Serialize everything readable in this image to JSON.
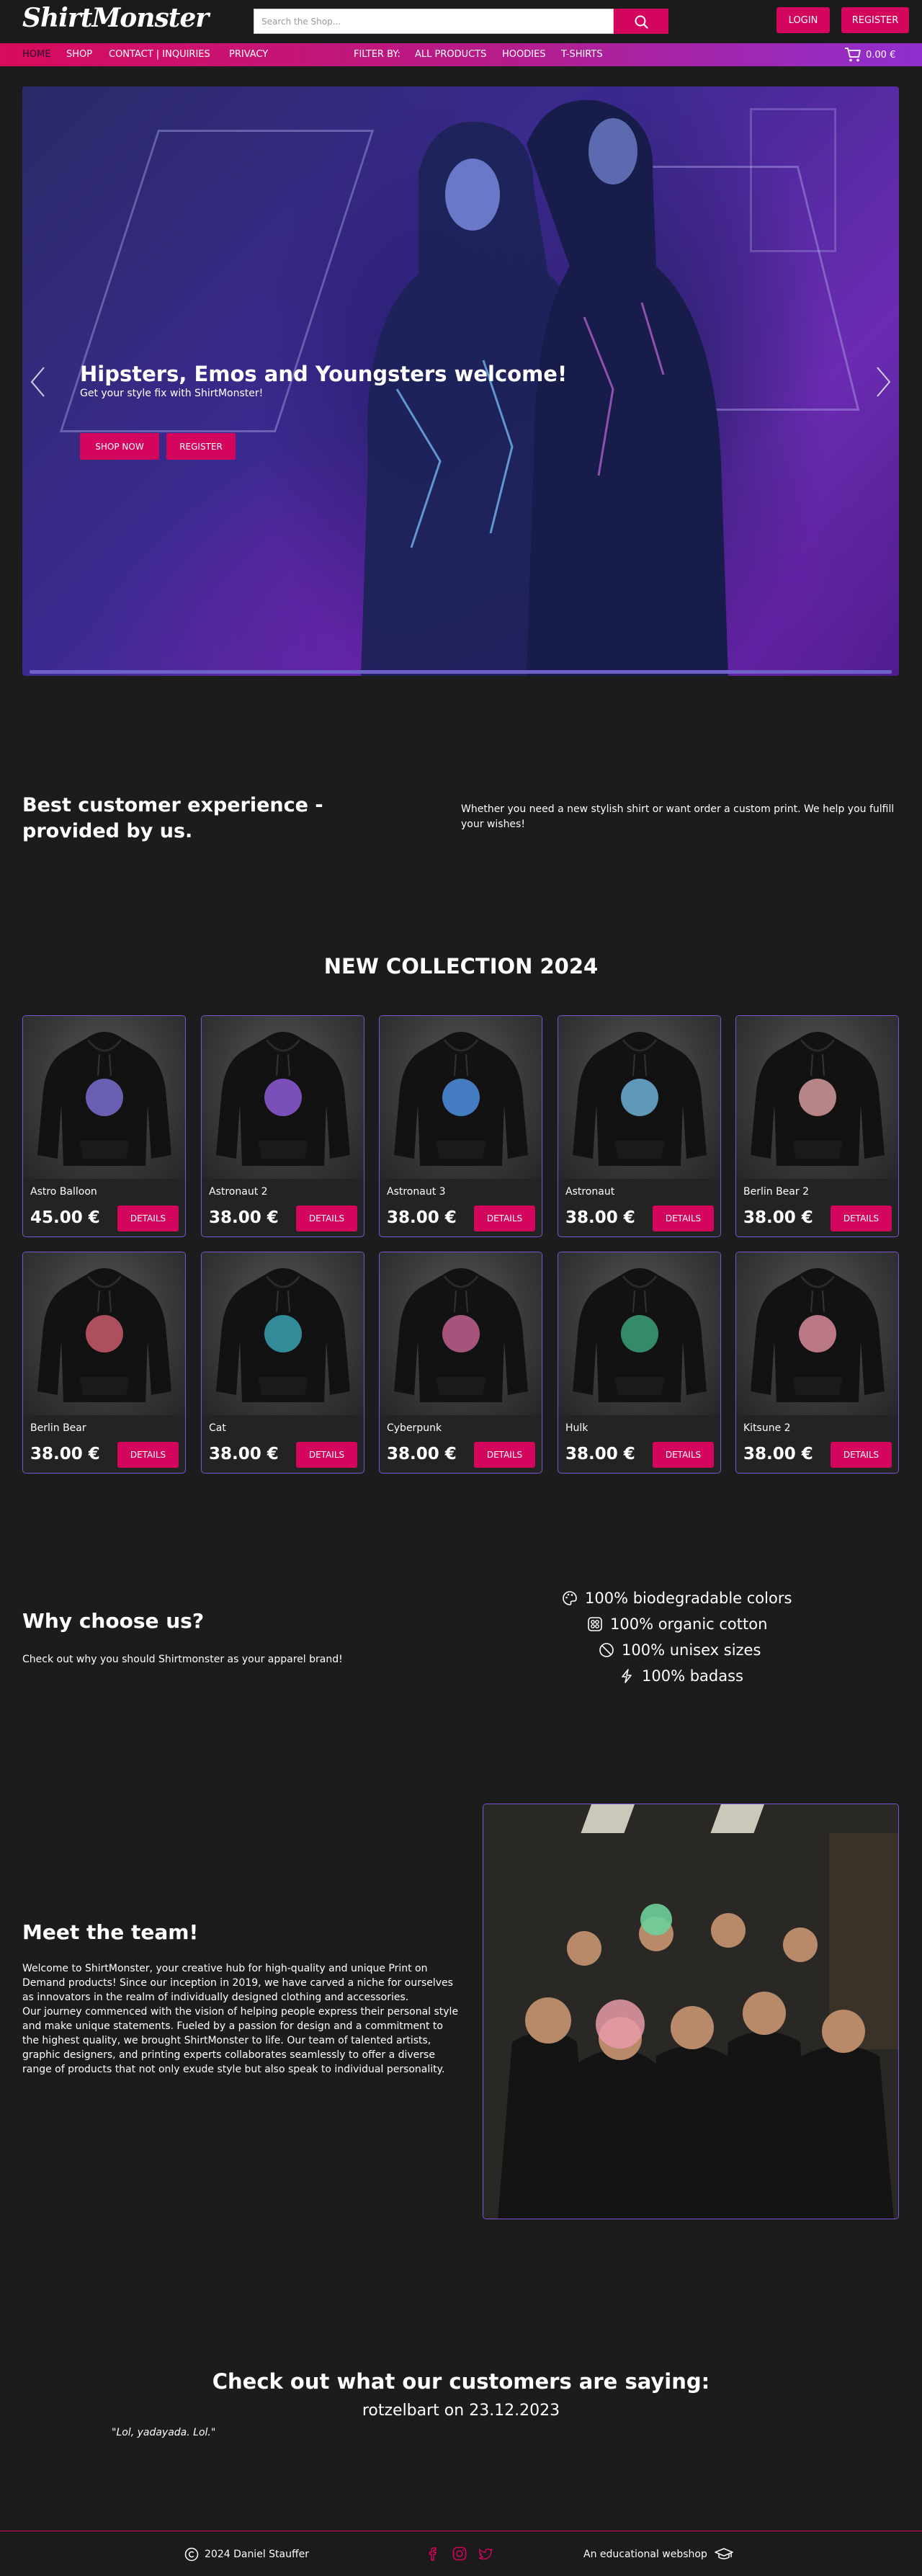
{
  "brand": {
    "logo_text": "ShirtMonster"
  },
  "search": {
    "placeholder": "Search the Shop..."
  },
  "auth": {
    "login_label": "LOGIN",
    "register_label": "REGISTER"
  },
  "nav": {
    "items": [
      "HOME",
      "SHOP",
      "CONTACT | INQUIRIES",
      "PRIVACY"
    ],
    "filter_label": "FILTER BY:",
    "filters": [
      "ALL PRODUCTS",
      "HOODIES",
      "T-SHIRTS"
    ],
    "cart_total": "0.00 €"
  },
  "hero": {
    "title": "Hipsters, Emos and Youngsters welcome!",
    "subtitle": "Get your style fix with ShirtMonster!",
    "shop_label": "SHOP NOW",
    "register_label": "REGISTER"
  },
  "experience": {
    "title": "Best customer experience - provided by us.",
    "text": "Whether you need a new stylish shirt or want order a custom print. We help you fulfill your wishes!"
  },
  "collection": {
    "title": "NEW COLLECTION 2024",
    "details_label": "DETAILS",
    "products": [
      {
        "name": "Astro Balloon",
        "price": "45.00 €",
        "print_color": "#7a6fd0"
      },
      {
        "name": "Astronaut 2",
        "price": "38.00 €",
        "print_color": "#8e5bd6"
      },
      {
        "name": "Astronaut 3",
        "price": "38.00 €",
        "print_color": "#4f8fe0"
      },
      {
        "name": "Astronaut",
        "price": "38.00 €",
        "print_color": "#6fb0d8"
      },
      {
        "name": "Berlin Bear 2",
        "price": "38.00 €",
        "print_color": "#d49a9a"
      },
      {
        "name": "Berlin Bear",
        "price": "38.00 €",
        "print_color": "#c95a6a"
      },
      {
        "name": "Cat",
        "price": "38.00 €",
        "print_color": "#3aa0b0"
      },
      {
        "name": "Cyberpunk",
        "price": "38.00 €",
        "print_color": "#c26090"
      },
      {
        "name": "Hulk",
        "price": "38.00 €",
        "print_color": "#3ca07a"
      },
      {
        "name": "Kitsune 2",
        "price": "38.00 €",
        "print_color": "#d88a9a"
      }
    ]
  },
  "why": {
    "title": "Why choose us?",
    "subtitle": "Check out why you should Shirtmonster as your apparel brand!",
    "features": [
      {
        "icon": "palette-icon",
        "text": "100% biodegradable colors"
      },
      {
        "icon": "cotton-icon",
        "text": "100% organic cotton"
      },
      {
        "icon": "unisex-icon",
        "text": "100% unisex sizes"
      },
      {
        "icon": "lightning-icon",
        "text": "100% badass"
      }
    ]
  },
  "team": {
    "title": "Meet the team!",
    "paragraph_1": "Welcome to ShirtMonster, your creative hub for high-quality and unique Print on Demand products! Since our inception in 2019, we have carved a niche for ourselves as innovators in the realm of individually designed clothing and accessories.",
    "paragraph_2": "Our journey commenced with the vision of helping people express their personal style and make unique statements. Fueled by a passion for design and a commitment to the highest quality, we brought ShirtMonster to life. Our team of talented artists, graphic designers, and printing experts collaborates seamlessly to offer a diverse range of products that not only exude style but also speak to individual personality."
  },
  "testimonials": {
    "title": "Check out what our customers are saying:",
    "author": "rotzelbart on 23.12.2023",
    "quote": "\"Lol, yadayada. Lol.\""
  },
  "footer": {
    "copyright": "2024 Daniel Stauffer",
    "tagline": "An educational webshop"
  },
  "colors": {
    "accent": "#d4055d",
    "card_border": "#7b55d6",
    "background": "#1c1c1c"
  }
}
